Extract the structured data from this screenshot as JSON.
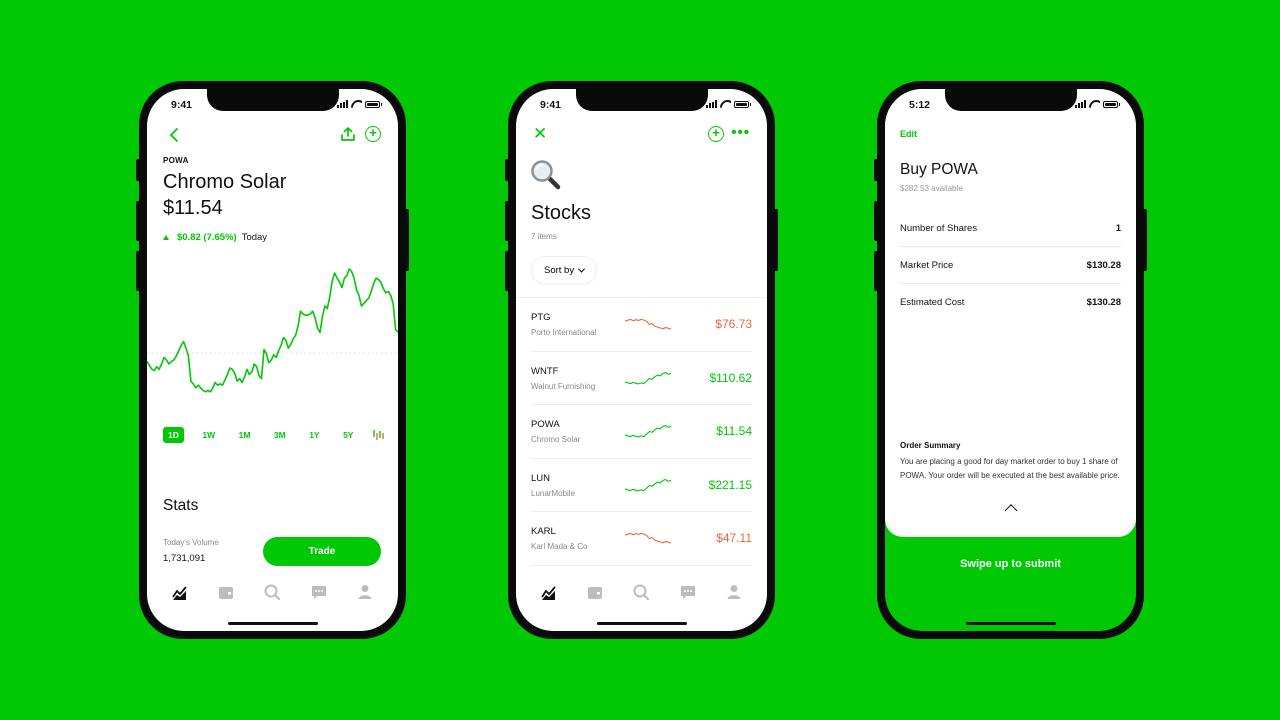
{
  "colors": {
    "brand_green": "#00c805",
    "loss_red": "#e9683c",
    "background": "#00c805"
  },
  "phone1": {
    "status_time": "9:41",
    "nav": {
      "back_icon": "chevron-left-icon",
      "share_icon": "share-icon",
      "add_icon": "plus-circle-icon"
    },
    "ticker": "POWA",
    "company": "Chromo Solar",
    "price": "$11.54",
    "change": "$0.82 (7.65%)",
    "change_period": "Today",
    "ranges": [
      "1D",
      "1W",
      "1M",
      "3M",
      "1Y",
      "5Y"
    ],
    "active_range": "1D",
    "candle_icon": "candlestick-icon",
    "stats_title": "Stats",
    "volume_label": "Today's Volume",
    "volume_value": "1,731,091",
    "trade_label": "Trade",
    "chart_series": [
      0.3,
      0.27,
      0.24,
      0.23,
      0.26,
      0.24,
      0.28,
      0.33,
      0.31,
      0.28,
      0.3,
      0.31,
      0.34,
      0.38,
      0.42,
      0.45,
      0.4,
      0.34,
      0.15,
      0.13,
      0.1,
      0.12,
      0.1,
      0.08,
      0.07,
      0.08,
      0.07,
      0.1,
      0.14,
      0.12,
      0.13,
      0.12,
      0.16,
      0.2,
      0.25,
      0.24,
      0.21,
      0.15,
      0.17,
      0.14,
      0.18,
      0.24,
      0.2,
      0.22,
      0.28,
      0.26,
      0.19,
      0.17,
      0.39,
      0.36,
      0.29,
      0.31,
      0.35,
      0.33,
      0.38,
      0.42,
      0.48,
      0.46,
      0.4,
      0.43,
      0.47,
      0.5,
      0.57,
      0.68,
      0.66,
      0.65,
      0.65,
      0.66,
      0.68,
      0.63,
      0.55,
      0.52,
      0.64,
      0.72,
      0.7,
      0.79,
      0.91,
      0.97,
      0.93,
      0.9,
      0.86,
      0.93,
      0.95,
      1.0,
      0.98,
      0.93,
      0.84,
      0.8,
      0.72,
      0.74,
      0.76,
      0.78,
      0.83,
      0.89,
      0.93,
      0.92,
      0.9,
      0.85,
      0.82,
      0.83,
      0.8,
      0.74,
      0.54,
      0.52
    ],
    "tabbar": [
      "chart-icon",
      "wallet-icon",
      "search-icon",
      "messages-icon",
      "profile-icon"
    ]
  },
  "phone2": {
    "status_time": "9:41",
    "nav": {
      "close_icon": "close-icon",
      "add_icon": "plus-circle-icon",
      "more_icon": "more-icon"
    },
    "emoji_icon": "magnifying-glass-emoji-icon",
    "title": "Stocks",
    "item_count": "7 items",
    "sort_label": "Sort by",
    "stocks": [
      {
        "symbol": "PTG",
        "company": "Porto International",
        "price": "$76.73",
        "trend": "down"
      },
      {
        "symbol": "WNTF",
        "company": "Walnut Furnishing",
        "price": "$110.62",
        "trend": "up"
      },
      {
        "symbol": "POWA",
        "company": "Chromo Solar",
        "price": "$11.54",
        "trend": "up"
      },
      {
        "symbol": "LUN",
        "company": "LunarMobile",
        "price": "$221.15",
        "trend": "up"
      },
      {
        "symbol": "KARL",
        "company": "Karl Mada & Co",
        "price": "$47.11",
        "trend": "down"
      }
    ],
    "tabbar": [
      "chart-icon",
      "wallet-icon",
      "search-icon",
      "messages-icon",
      "profile-icon"
    ]
  },
  "phone3": {
    "status_time": "5:12",
    "edit_label": "Edit",
    "title": "Buy POWA",
    "available": "$282.53 available",
    "rows": [
      {
        "label": "Number of Shares",
        "value": "1"
      },
      {
        "label": "Market Price",
        "value": "$130.28"
      },
      {
        "label": "Estimated Cost",
        "value": "$130.28"
      }
    ],
    "summary_title": "Order Summary",
    "summary_text": "You are placing a good for day market order to buy 1 share of POWA. Your order will be executed at the best available price.",
    "swipe_label": "Swipe up to submit"
  }
}
